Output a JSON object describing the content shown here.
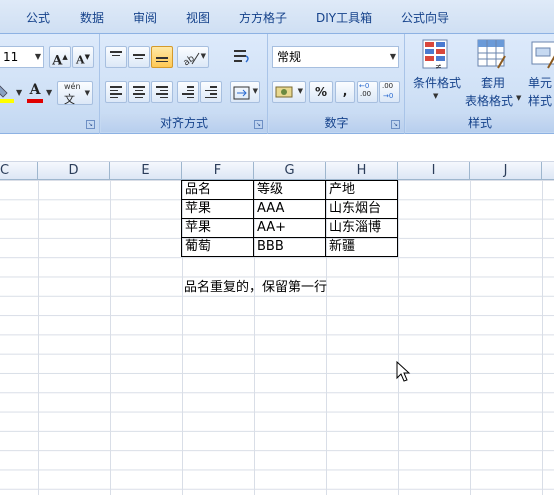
{
  "tabs": [
    "公式",
    "数据",
    "审阅",
    "视图",
    "方方格子",
    "DIY工具箱",
    "公式向导"
  ],
  "font_group": {
    "font_size": "11",
    "grow_label": "A",
    "shrink_label": "A",
    "font_color_label": "A",
    "phonetic_top": "wén",
    "phonetic_bottom": "文"
  },
  "alignment_group": {
    "label": "对齐方式"
  },
  "number_group": {
    "label": "数字",
    "format_value": "常规",
    "percent": "%",
    "comma": ",",
    "inc_decimal": ".00",
    "dec_decimal": ".00"
  },
  "styles_group": {
    "label": "样式",
    "conditional_format": "条件格式",
    "table_format_top": "套用",
    "table_format_bottom": "表格格式",
    "cell_style_top": "单元",
    "cell_style_bottom": "样式"
  },
  "columns": [
    "C",
    "D",
    "E",
    "F",
    "G",
    "H",
    "I",
    "J"
  ],
  "table": {
    "header": [
      "品名",
      "等级",
      "产地"
    ],
    "rows": [
      [
        "苹果",
        "AAA",
        "山东烟台"
      ],
      [
        "苹果",
        "AA+",
        "山东淄博"
      ],
      [
        "葡萄",
        "BBB",
        "新疆"
      ]
    ]
  },
  "note": "品名重复的，保留第一行",
  "colors": {
    "tab_text": "#15428b",
    "ribbon_bg": "#d0e1f6",
    "active_button": "#ffc955",
    "font_color_bar": "#e00000",
    "highlight_bar": "#ffff00"
  }
}
